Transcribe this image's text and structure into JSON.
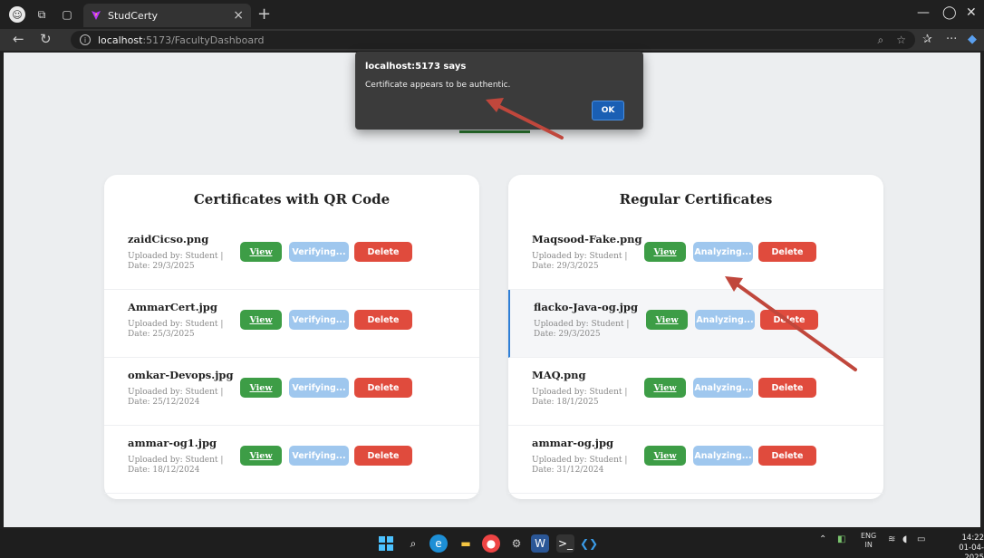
{
  "browser": {
    "tab_title": "StudCerty",
    "tab_close": "×",
    "new_tab": "+",
    "url_host": "localhost",
    "url_rest": ":5173/FacultyDashboard"
  },
  "dialog": {
    "title": "localhost:5173 says",
    "message": "Certificate appears to be authentic.",
    "ok_label": "OK"
  },
  "qr_section": {
    "title": "Certificates with QR Code",
    "status_label": "Verifying...",
    "rows": [
      {
        "name": "zaidCicso.png",
        "uploaded": "Uploaded by: Student |",
        "date": "Date: 29/3/2025"
      },
      {
        "name": "AmmarCert.jpg",
        "uploaded": "Uploaded by: Student |",
        "date": "Date: 25/3/2025"
      },
      {
        "name": "omkar-Devops.jpg",
        "uploaded": "Uploaded by: Student |",
        "date": "Date: 25/12/2024"
      },
      {
        "name": "ammar-og1.jpg",
        "uploaded": "Uploaded by: Student |",
        "date": "Date: 18/12/2024"
      }
    ]
  },
  "regular_section": {
    "title": "Regular Certificates",
    "status_label": "Analyzing...",
    "rows": [
      {
        "name": "Maqsood-Fake.png",
        "uploaded": "Uploaded by: Student |",
        "date": "Date: 29/3/2025"
      },
      {
        "name": "flacko-Java-og.jpg",
        "uploaded": "Uploaded by: Student |",
        "date": "Date: 29/3/2025"
      },
      {
        "name": "MAQ.png",
        "uploaded": "Uploaded by: Student |",
        "date": "Date: 18/1/2025"
      },
      {
        "name": "ammar-og.jpg",
        "uploaded": "Uploaded by: Student |",
        "date": "Date: 31/12/2024"
      }
    ]
  },
  "buttons": {
    "view": "View",
    "delete": "Delete"
  },
  "taskbar": {
    "lang_top": "ENG",
    "lang_bottom": "IN",
    "time": "14:22",
    "date": "01-04-2025"
  },
  "colors": {
    "view_button": "#3d9d46",
    "status_button": "#9fc7ee",
    "delete_button": "#e04b3d",
    "annotation_arrow": "#c0473c",
    "dialog_ok": "#1a5fb4"
  }
}
